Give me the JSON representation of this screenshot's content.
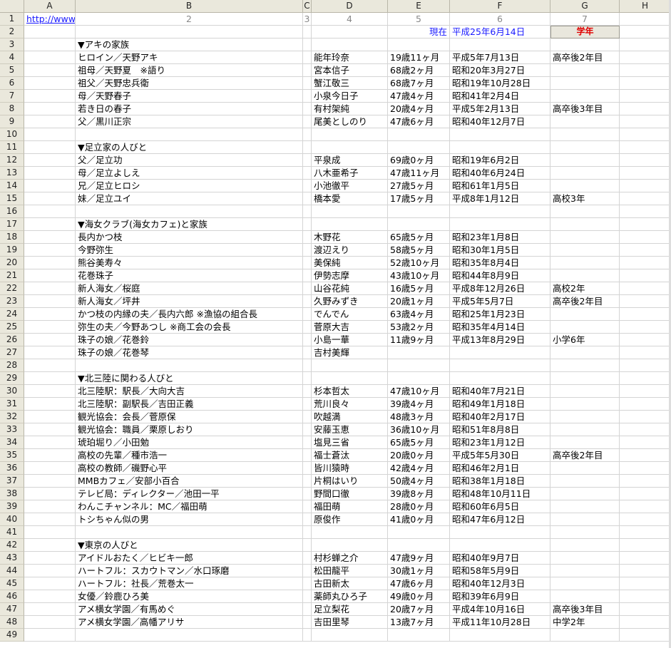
{
  "columns": [
    "A",
    "B",
    "C",
    "D",
    "E",
    "F",
    "G",
    "H"
  ],
  "row1": {
    "a": "http://www",
    "b": "2",
    "c": "3",
    "d": "4",
    "e": "5",
    "f": "6",
    "g": "7"
  },
  "row2": {
    "e": "現在",
    "f": "平成25年6月14日",
    "g": "学年"
  },
  "rows": [
    {
      "n": "3",
      "b": "▼アキの家族",
      "d": "",
      "e": "",
      "f": "",
      "g": ""
    },
    {
      "n": "4",
      "b": "ヒロイン／天野アキ",
      "d": "能年玲奈",
      "e": "19歳11ヶ月",
      "f": "平成5年7月13日",
      "g": "高卒後2年目"
    },
    {
      "n": "5",
      "b": "祖母／天野夏　※語り",
      "d": "宮本信子",
      "e": "68歳2ヶ月",
      "f": "昭和20年3月27日",
      "g": ""
    },
    {
      "n": "6",
      "b": "祖父／天野忠兵衛",
      "d": "蟹江敬三",
      "e": "68歳7ヶ月",
      "f": "昭和19年10月28日",
      "g": ""
    },
    {
      "n": "7",
      "b": "母／天野春子",
      "d": "小泉今日子",
      "e": "47歳4ヶ月",
      "f": "昭和41年2月4日",
      "g": ""
    },
    {
      "n": "8",
      "b": "若き日の春子",
      "d": "有村架純",
      "e": "20歳4ヶ月",
      "f": "平成5年2月13日",
      "g": "高卒後3年目"
    },
    {
      "n": "9",
      "b": "父／黒川正宗",
      "d": "尾美としのり",
      "e": "47歳6ヶ月",
      "f": "昭和40年12月7日",
      "g": ""
    },
    {
      "n": "10",
      "b": "",
      "d": "",
      "e": "",
      "f": "",
      "g": ""
    },
    {
      "n": "11",
      "b": "▼足立家の人びと",
      "d": "",
      "e": "",
      "f": "",
      "g": ""
    },
    {
      "n": "12",
      "b": "父／足立功",
      "d": "平泉成",
      "e": "69歳0ヶ月",
      "f": "昭和19年6月2日",
      "g": ""
    },
    {
      "n": "13",
      "b": "母／足立よしえ",
      "d": "八木亜希子",
      "e": "47歳11ヶ月",
      "f": "昭和40年6月24日",
      "g": ""
    },
    {
      "n": "14",
      "b": "兄／足立ヒロシ",
      "d": "小池徹平",
      "e": "27歳5ヶ月",
      "f": "昭和61年1月5日",
      "g": ""
    },
    {
      "n": "15",
      "b": "妹／足立ユイ",
      "d": "橋本愛",
      "e": "17歳5ヶ月",
      "f": "平成8年1月12日",
      "g": "高校3年"
    },
    {
      "n": "16",
      "b": "",
      "d": "",
      "e": "",
      "f": "",
      "g": ""
    },
    {
      "n": "17",
      "b": "▼海女クラブ(海女カフェ)と家族",
      "d": "",
      "e": "",
      "f": "",
      "g": ""
    },
    {
      "n": "18",
      "b": "長内かつ枝",
      "d": "木野花",
      "e": "65歳5ヶ月",
      "f": "昭和23年1月8日",
      "g": ""
    },
    {
      "n": "19",
      "b": "今野弥生",
      "d": "渡辺えり",
      "e": "58歳5ヶ月",
      "f": "昭和30年1月5日",
      "g": ""
    },
    {
      "n": "20",
      "b": "熊谷美寿々",
      "d": "美保純",
      "e": "52歳10ヶ月",
      "f": "昭和35年8月4日",
      "g": ""
    },
    {
      "n": "21",
      "b": "花巻珠子",
      "d": "伊勢志摩",
      "e": "43歳10ヶ月",
      "f": "昭和44年8月9日",
      "g": ""
    },
    {
      "n": "22",
      "b": "新人海女／桜庭",
      "d": "山谷花純",
      "e": "16歳5ヶ月",
      "f": "平成8年12月26日",
      "g": "高校2年"
    },
    {
      "n": "23",
      "b": "新人海女／坪井",
      "d": "久野みずき",
      "e": "20歳1ヶ月",
      "f": "平成5年5月7日",
      "g": "高卒後2年目"
    },
    {
      "n": "24",
      "b": "かつ枝の内縁の夫／長内六郎 ※漁協の組合長",
      "d": "でんでん",
      "e": "63歳4ヶ月",
      "f": "昭和25年1月23日",
      "g": ""
    },
    {
      "n": "25",
      "b": "弥生の夫／今野あつし ※商工会の会長",
      "d": "菅原大吉",
      "e": "53歳2ヶ月",
      "f": "昭和35年4月14日",
      "g": ""
    },
    {
      "n": "26",
      "b": "珠子の娘／花巻鈴",
      "d": "小島一華",
      "e": "11歳9ヶ月",
      "f": "平成13年8月29日",
      "g": "小学6年"
    },
    {
      "n": "27",
      "b": "珠子の娘／花巻琴",
      "d": "吉村美輝",
      "e": "",
      "f": "",
      "g": ""
    },
    {
      "n": "28",
      "b": "",
      "d": "",
      "e": "",
      "f": "",
      "g": ""
    },
    {
      "n": "29",
      "b": "▼北三陸に関わる人びと",
      "d": "",
      "e": "",
      "f": "",
      "g": ""
    },
    {
      "n": "30",
      "b": "北三陸駅：駅長／大向大吉",
      "d": "杉本哲太",
      "e": "47歳10ヶ月",
      "f": "昭和40年7月21日",
      "g": ""
    },
    {
      "n": "31",
      "b": "北三陸駅：副駅長／吉田正義",
      "d": "荒川良々",
      "e": "39歳4ヶ月",
      "f": "昭和49年1月18日",
      "g": ""
    },
    {
      "n": "32",
      "b": "観光協会：会長／菅原保",
      "d": "吹越満",
      "e": "48歳3ヶ月",
      "f": "昭和40年2月17日",
      "g": ""
    },
    {
      "n": "33",
      "b": "観光協会：職員／栗原しおり",
      "d": "安藤玉恵",
      "e": "36歳10ヶ月",
      "f": "昭和51年8月8日",
      "g": ""
    },
    {
      "n": "34",
      "b": "琥珀堀り／小田勉",
      "d": "塩見三省",
      "e": "65歳5ヶ月",
      "f": "昭和23年1月12日",
      "g": ""
    },
    {
      "n": "35",
      "b": "高校の先輩／種市浩一",
      "d": "福士蒼汰",
      "e": "20歳0ヶ月",
      "f": "平成5年5月30日",
      "g": "高卒後2年目"
    },
    {
      "n": "36",
      "b": "高校の教師／磯野心平",
      "d": "皆川猿時",
      "e": "42歳4ヶ月",
      "f": "昭和46年2月1日",
      "g": ""
    },
    {
      "n": "37",
      "b": "MMBカフェ／安部小百合",
      "d": "片桐はいり",
      "e": "50歳4ヶ月",
      "f": "昭和38年1月18日",
      "g": ""
    },
    {
      "n": "38",
      "b": "テレビ局：ディレクター／池田一平",
      "d": "野間口徹",
      "e": "39歳8ヶ月",
      "f": "昭和48年10月11日",
      "g": ""
    },
    {
      "n": "39",
      "b": "わんこチャンネル：MC／福田萌",
      "d": "福田萌",
      "e": "28歳0ヶ月",
      "f": "昭和60年6月5日",
      "g": ""
    },
    {
      "n": "40",
      "b": "トシちゃん似の男",
      "d": "原俊作",
      "e": "41歳0ヶ月",
      "f": "昭和47年6月12日",
      "g": ""
    },
    {
      "n": "41",
      "b": "",
      "d": "",
      "e": "",
      "f": "",
      "g": ""
    },
    {
      "n": "42",
      "b": "▼東京の人びと",
      "d": "",
      "e": "",
      "f": "",
      "g": ""
    },
    {
      "n": "43",
      "b": "アイドルおたく／ヒビキ一郎",
      "d": "村杉蝉之介",
      "e": "47歳9ヶ月",
      "f": "昭和40年9月7日",
      "g": ""
    },
    {
      "n": "44",
      "b": "ハートフル：スカウトマン／水口琢磨",
      "d": "松田龍平",
      "e": "30歳1ヶ月",
      "f": "昭和58年5月9日",
      "g": ""
    },
    {
      "n": "45",
      "b": "ハートフル：社長／荒巻太一",
      "d": "古田新太",
      "e": "47歳6ヶ月",
      "f": "昭和40年12月3日",
      "g": ""
    },
    {
      "n": "46",
      "b": "女優／鈴鹿ひろ美",
      "d": "薬師丸ひろ子",
      "e": "49歳0ヶ月",
      "f": "昭和39年6月9日",
      "g": ""
    },
    {
      "n": "47",
      "b": "アメ横女学園／有馬めぐ",
      "d": "足立梨花",
      "e": "20歳7ヶ月",
      "f": "平成4年10月16日",
      "g": "高卒後3年目"
    },
    {
      "n": "48",
      "b": "アメ横女学園／高幡アリサ",
      "d": "吉田里琴",
      "e": "13歳7ヶ月",
      "f": "平成11年10月28日",
      "g": "中学2年"
    },
    {
      "n": "49",
      "b": "",
      "d": "",
      "e": "",
      "f": "",
      "g": ""
    }
  ]
}
